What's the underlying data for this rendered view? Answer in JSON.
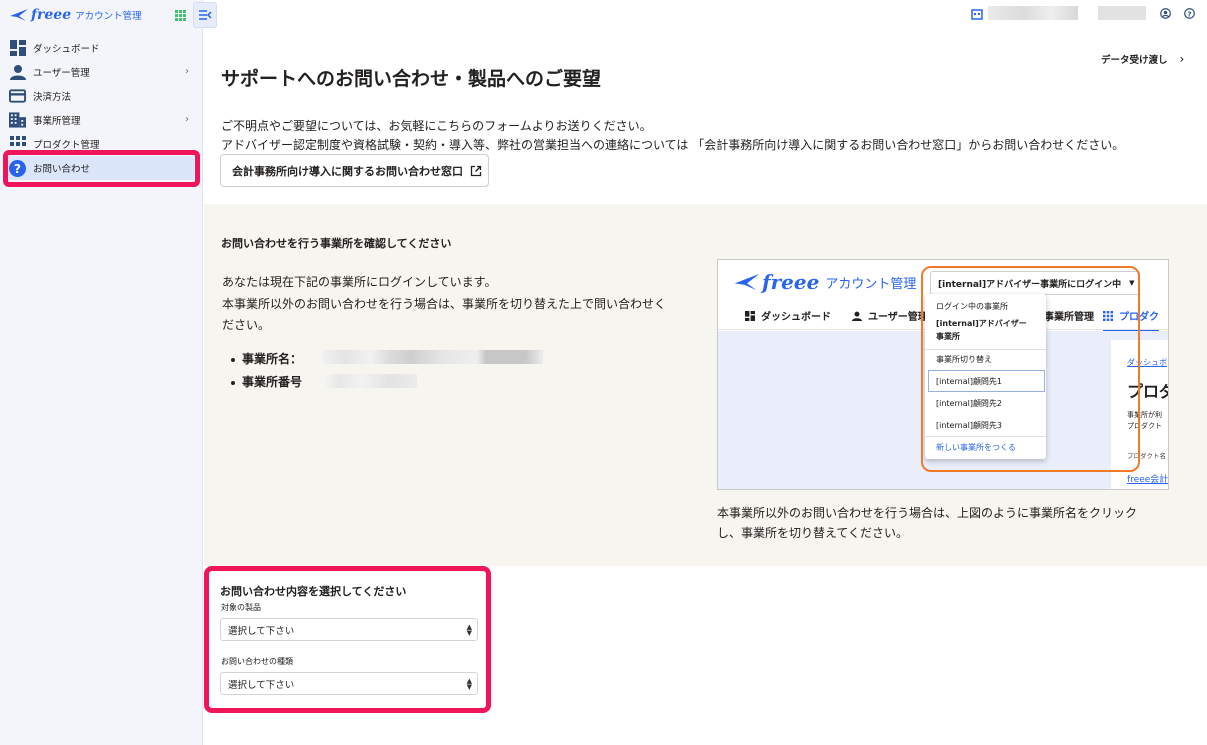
{
  "brand": {
    "logo": "freee",
    "app_name": "アカウント管理"
  },
  "sidebar": {
    "items": [
      {
        "label": "ダッシュボード",
        "icon": "dashboard-icon",
        "has_submenu": false
      },
      {
        "label": "ユーザー管理",
        "icon": "user-icon",
        "has_submenu": true
      },
      {
        "label": "決済方法",
        "icon": "credit-card-icon",
        "has_submenu": false
      },
      {
        "label": "事業所管理",
        "icon": "building-icon",
        "has_submenu": true
      },
      {
        "label": "プロダクト管理",
        "icon": "apps-grid-icon",
        "has_submenu": false
      },
      {
        "label": "お問い合わせ",
        "icon": "help-icon",
        "has_submenu": false,
        "active": true
      }
    ]
  },
  "header": {
    "data_transfer_link": "データ受け渡し",
    "page_title": "サポートへのお問い合わせ・製品へのご要望",
    "intro_line1": "ご不明点やご要望については、お気軽にこちらのフォームよりお送りください。",
    "intro_line2": "アドバイザー認定制度や資格試験・契約・導入等、弊社の営業担当への連絡については 「会計事務所向け導入に関するお問い合わせ窓口」からお問い合わせください。",
    "external_button": "会計事務所向け導入に関するお問い合わせ窓口"
  },
  "confirm": {
    "title": "お問い合わせを行う事業所を確認してください",
    "text_line1": "あなたは現在下記の事業所にログインしています。",
    "text_line2": "本事業所以外のお問い合わせを行う場合は、事業所を切り替えた上で問い合わせく",
    "text_line3": "ださい。",
    "office_name_label": "事業所名：",
    "office_number_label": "事業所番号",
    "caption_line1": "本事業所以外のお問い合わせを行う場合は、上図のように事業所名をクリック",
    "caption_line2": "し、事業所を切り替えてください。"
  },
  "illustration": {
    "logo": "freee",
    "app_name": "アカウント管理",
    "switcher": "[internal]アドバイザー事業所にログイン中",
    "nav": [
      "ダッシュボード",
      "ユーザー管理",
      "事業所管理",
      "プロダク"
    ],
    "dropdown": {
      "current_label": "ログイン中の事業所",
      "current_office_line1": "[internal]アドバイザー",
      "current_office_line2": "事業所",
      "switch_label": "事業所切り替え",
      "options": [
        "[internal]顧問先1",
        "[internal]顧問先2",
        "[internal]顧問先3"
      ],
      "create_new": "新しい事業所をつくる"
    },
    "card": {
      "breadcrumb": "ダッシュボ",
      "heading": "プロダ",
      "text_line1": "事業所が利",
      "text_line2": "プロダクト",
      "sub": "プロダクト名",
      "link": "freee会計"
    }
  },
  "form": {
    "title": "お問い合わせ内容を選択してください",
    "product_label": "対象の製品",
    "product_value": "選択して下さい",
    "type_label": "お問い合わせの種類",
    "type_value": "選択して下さい"
  },
  "colors": {
    "brand_blue": "#2864f0",
    "highlight_pink": "#f0145a",
    "highlight_orange": "#f07a28",
    "sidebar_bg": "#f3f5fb",
    "active_bg": "#dce6fb"
  }
}
